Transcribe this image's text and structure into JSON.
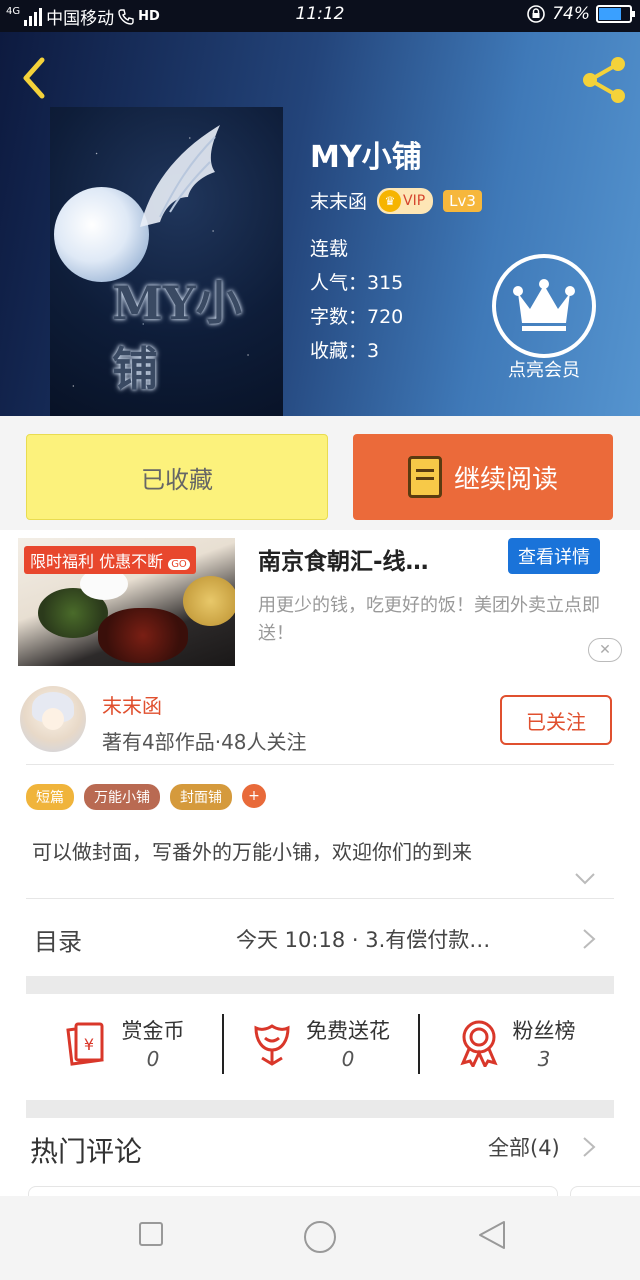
{
  "status_bar": {
    "network_label": "4G",
    "carrier": "中国移动",
    "hd_label": "HD",
    "time": "11:12",
    "battery_percent": "74%",
    "battery_level": 0.74
  },
  "book": {
    "title": "MY小铺",
    "cover_text": "MY小铺",
    "author": "末末函",
    "vip_label": "VIP",
    "level_label": "Lv3",
    "status": "连载",
    "popularity": "人气：315",
    "word_count": "字数：720",
    "favorites": "收藏：3"
  },
  "member": {
    "label": "点亮会员"
  },
  "actions": {
    "favorited_label": "已收藏",
    "continue_label": "继续阅读"
  },
  "ad": {
    "banner": "限时福利 优惠不断",
    "banner_go": "GO",
    "title": "南京食朝汇-线…",
    "detail_button": "查看详情",
    "description": "用更少的钱，吃更好的饭！美团外卖立点即送！",
    "close": "✕"
  },
  "author_card": {
    "name": "末末函",
    "summary": "著有4部作品·48人关注",
    "follow_label": "已关注",
    "tags": [
      {
        "label": "短篇",
        "color": "#f0b43b"
      },
      {
        "label": "万能小铺",
        "color": "#b96a52"
      },
      {
        "label": "封面铺",
        "color": "#d59a3c"
      }
    ],
    "tag_add": "+",
    "intro": "可以做封面，写番外的万能小铺，欢迎你们的到来"
  },
  "toc": {
    "label": "目录",
    "latest": "今天 10:18 · 3.有偿付款…"
  },
  "gifts": [
    {
      "name": "赏金币",
      "count": "0",
      "icon": "red-envelope-icon"
    },
    {
      "name": "免费送花",
      "count": "0",
      "icon": "flower-icon"
    },
    {
      "name": "粉丝榜",
      "count": "3",
      "icon": "award-ribbon-icon"
    }
  ],
  "comments": {
    "title": "热门评论",
    "all_label": "全部(4)"
  },
  "colors": {
    "accent_orange": "#eb6a3a",
    "favorite_yellow": "#fcf27c",
    "detail_blue": "#1a73d9",
    "author_red": "#e0502f"
  }
}
